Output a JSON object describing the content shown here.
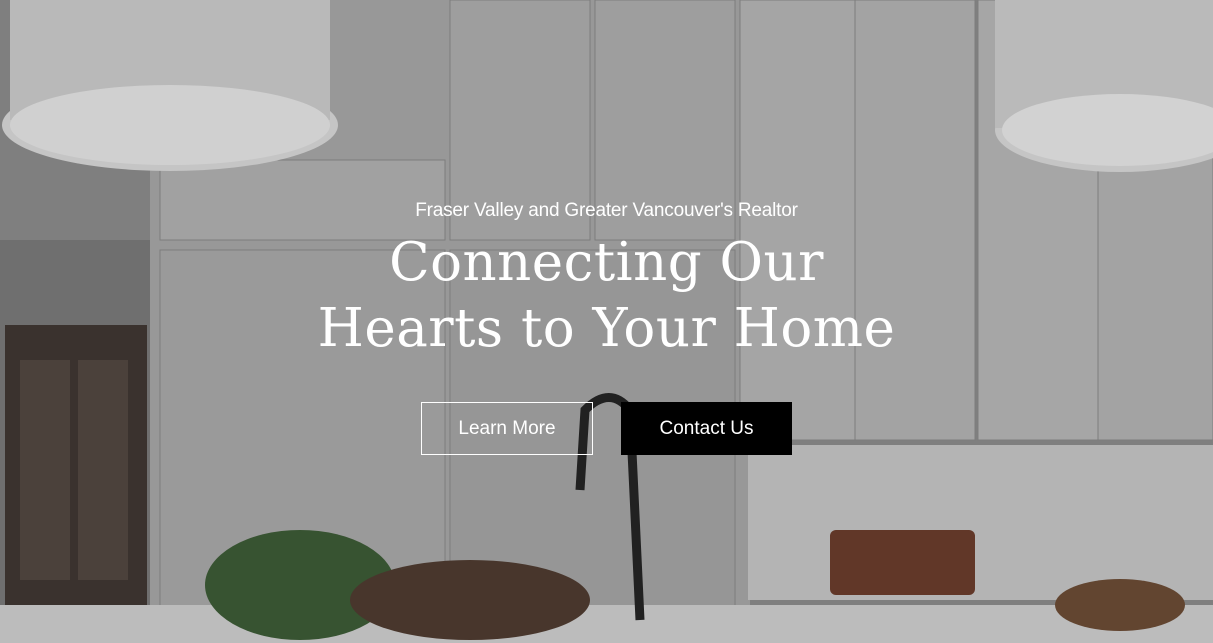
{
  "hero": {
    "eyebrow": "Fraser Valley and Greater Vancouver's Realtor",
    "headline_line1": "Connecting Our",
    "headline_line2": "Hearts to Your Home",
    "learn_more_label": "Learn More",
    "contact_label": "Contact Us"
  },
  "colors": {
    "text": "#ffffff",
    "button_solid_bg": "#000000",
    "button_outline_border": "#ffffff"
  },
  "background": {
    "image_subject": "kitchen-interior-photo"
  }
}
